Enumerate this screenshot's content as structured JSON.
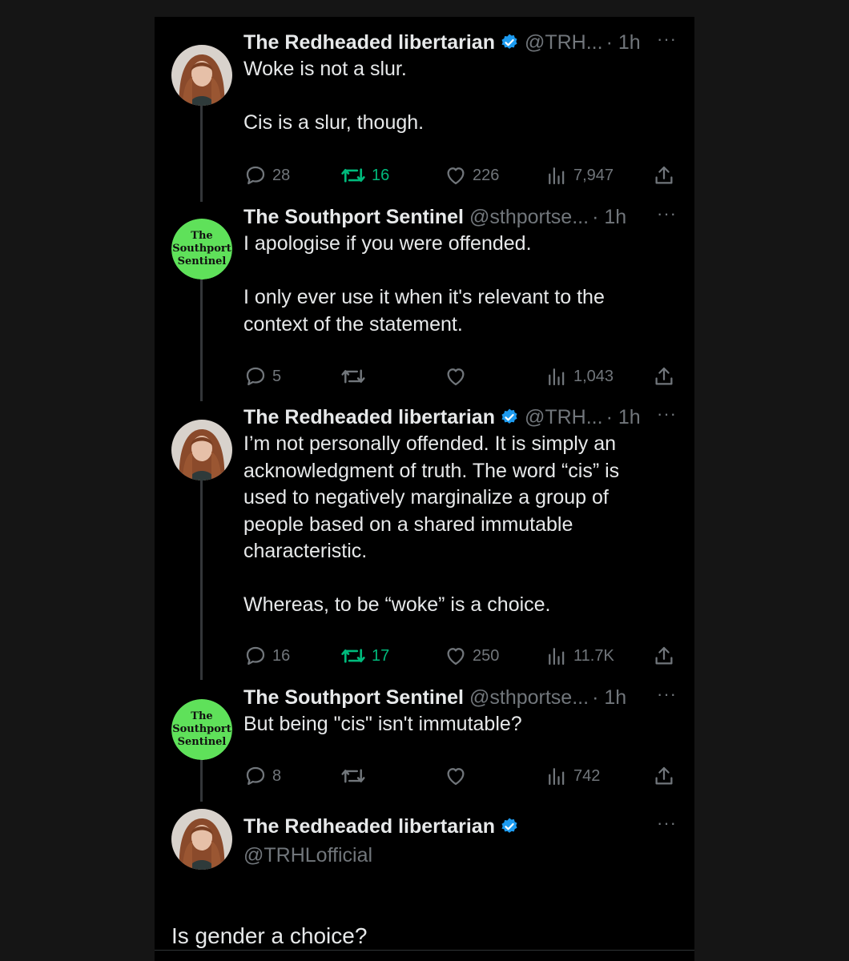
{
  "thread": {
    "tweets": [
      {
        "name": "The Redheaded libertarian",
        "verified": true,
        "handle": "@TRH...",
        "time": "· 1h",
        "paragraphs": [
          "Woke is not a slur.",
          "Cis is a slur, though."
        ],
        "replies": "28",
        "reposts": "16",
        "likes": "226",
        "views": "7,947"
      },
      {
        "name": "The Southport Sentinel",
        "verified": false,
        "handle": "@sthportse...",
        "time": "· 1h",
        "paragraphs": [
          "I apologise if you were offended.",
          "I only ever use it when it's relevant to the context of the statement."
        ],
        "replies": "5",
        "reposts": "",
        "likes": "",
        "views": "1,043"
      },
      {
        "name": "The Redheaded libertarian",
        "verified": true,
        "handle": "@TRH...",
        "time": "· 1h",
        "paragraphs": [
          "I’m not personally offended. It is simply an acknowledgment of truth. The word “cis” is used to negatively marginalize a group of people based on a shared immutable characteristic.",
          "Whereas, to be “woke” is a choice."
        ],
        "replies": "16",
        "reposts": "17",
        "likes": "250",
        "views": "11.7K"
      },
      {
        "name": "The Southport Sentinel",
        "verified": false,
        "handle": "@sthportse...",
        "time": "· 1h",
        "paragraphs": [
          "But being \"cis\" isn't immutable?"
        ],
        "replies": "8",
        "reposts": "",
        "likes": "",
        "views": "742"
      }
    ],
    "main_tweet": {
      "name": "The Redheaded libertarian",
      "handle": "@TRHLofficial",
      "text": "Is gender a choice?"
    },
    "more_icon": "···",
    "sentinel_logo_text": [
      "The",
      "Southport",
      "Sentinel"
    ]
  },
  "colors": {
    "background": "#000000",
    "text": "#e7e9ea",
    "muted": "#71767b",
    "verified": "#1d9bf0",
    "repost_active": "#00ba7c",
    "sentinel_green": "#5fe15a"
  }
}
